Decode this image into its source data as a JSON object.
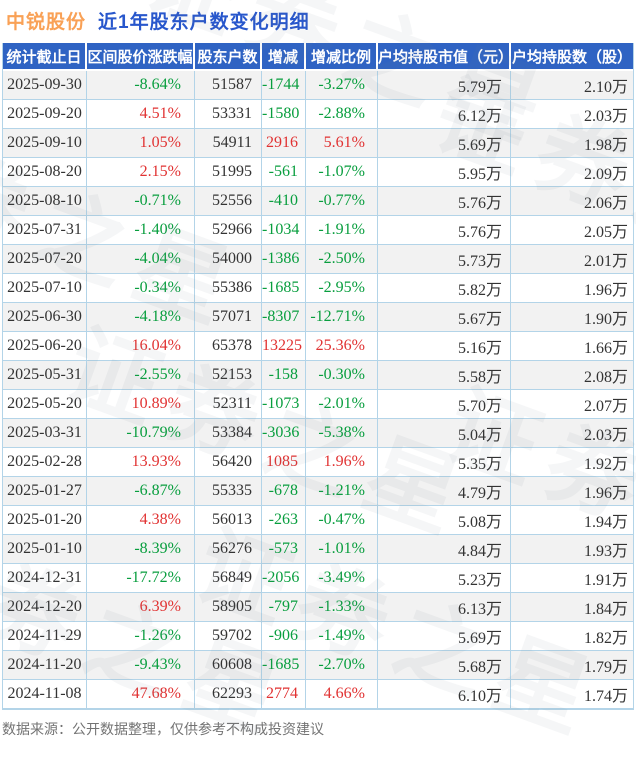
{
  "title": {
    "stock_name": "中锐股份",
    "subtitle": "近1年股东户数变化明细"
  },
  "watermark": {
    "text": "证券之星"
  },
  "chart_data": {
    "type": "table",
    "title": "中锐股份 近1年股东户数变化明细",
    "columns": [
      "统计截止日",
      "区间股价涨跌幅",
      "股东户数",
      "增减",
      "增减比例",
      "户均持股市值（元）",
      "户均持股数（股）"
    ],
    "rows": [
      [
        "2025-09-30",
        "-8.64%",
        "51587",
        "-1744",
        "-3.27%",
        "5.79万",
        "2.10万"
      ],
      [
        "2025-09-20",
        "4.51%",
        "53331",
        "-1580",
        "-2.88%",
        "6.12万",
        "2.03万"
      ],
      [
        "2025-09-10",
        "1.05%",
        "54911",
        "2916",
        "5.61%",
        "5.69万",
        "1.98万"
      ],
      [
        "2025-08-20",
        "2.15%",
        "51995",
        "-561",
        "-1.07%",
        "5.95万",
        "2.09万"
      ],
      [
        "2025-08-10",
        "-0.71%",
        "52556",
        "-410",
        "-0.77%",
        "5.76万",
        "2.06万"
      ],
      [
        "2025-07-31",
        "-1.40%",
        "52966",
        "-1034",
        "-1.91%",
        "5.76万",
        "2.05万"
      ],
      [
        "2025-07-20",
        "-4.04%",
        "54000",
        "-1386",
        "-2.50%",
        "5.73万",
        "2.01万"
      ],
      [
        "2025-07-10",
        "-0.34%",
        "55386",
        "-1685",
        "-2.95%",
        "5.82万",
        "1.96万"
      ],
      [
        "2025-06-30",
        "-4.18%",
        "57071",
        "-8307",
        "-12.71%",
        "5.67万",
        "1.90万"
      ],
      [
        "2025-06-20",
        "16.04%",
        "65378",
        "13225",
        "25.36%",
        "5.16万",
        "1.66万"
      ],
      [
        "2025-05-31",
        "-2.55%",
        "52153",
        "-158",
        "-0.30%",
        "5.58万",
        "2.08万"
      ],
      [
        "2025-05-20",
        "10.89%",
        "52311",
        "-1073",
        "-2.01%",
        "5.70万",
        "2.07万"
      ],
      [
        "2025-03-31",
        "-10.79%",
        "53384",
        "-3036",
        "-5.38%",
        "5.04万",
        "2.03万"
      ],
      [
        "2025-02-28",
        "13.93%",
        "56420",
        "1085",
        "1.96%",
        "5.35万",
        "1.92万"
      ],
      [
        "2025-01-27",
        "-6.87%",
        "55335",
        "-678",
        "-1.21%",
        "4.79万",
        "1.96万"
      ],
      [
        "2025-01-20",
        "4.38%",
        "56013",
        "-263",
        "-0.47%",
        "5.08万",
        "1.94万"
      ],
      [
        "2025-01-10",
        "-8.39%",
        "56276",
        "-573",
        "-1.01%",
        "4.84万",
        "1.93万"
      ],
      [
        "2024-12-31",
        "-17.72%",
        "56849",
        "-2056",
        "-3.49%",
        "5.23万",
        "1.91万"
      ],
      [
        "2024-12-20",
        "6.39%",
        "58905",
        "-797",
        "-1.33%",
        "6.13万",
        "1.84万"
      ],
      [
        "2024-11-29",
        "-1.26%",
        "59702",
        "-906",
        "-1.49%",
        "5.69万",
        "1.82万"
      ],
      [
        "2024-11-20",
        "-9.43%",
        "60608",
        "-1685",
        "-2.70%",
        "5.68万",
        "1.79万"
      ],
      [
        "2024-11-08",
        "47.68%",
        "62293",
        "2774",
        "4.66%",
        "6.10万",
        "1.74万"
      ]
    ],
    "colored_columns": [
      1,
      3,
      4
    ],
    "color_rule": "values starting with '-' are green (decline), others red (rise)"
  },
  "footer": {
    "note": "数据来源：公开数据整理，仅供参考不构成投资建议"
  },
  "colors": {
    "header_bg": "#2f63c3",
    "title_stock": "#f9a156",
    "title_subtitle": "#2857cc",
    "positive_red": "#e13232",
    "negative_green": "#089e3e",
    "border": "#b3d4e8",
    "row_alt": "#f2f2f2",
    "cell_text": "#333333",
    "footer_text": "#737373"
  }
}
